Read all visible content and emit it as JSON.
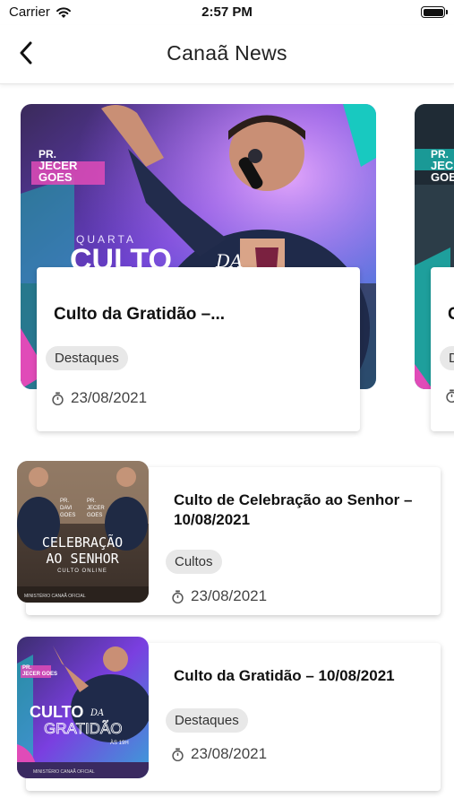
{
  "status": {
    "carrier": "Carrier",
    "time": "2:57 PM"
  },
  "header": {
    "title": "Canaã News"
  },
  "featured": [
    {
      "title": "Culto da Gratidão –...",
      "category": "Destaques",
      "date": "23/08/2021",
      "image_text": {
        "pastor": "PR. JECER GOES",
        "day": "QUARTA",
        "headline": "CULTO DA"
      }
    },
    {
      "title": "C",
      "category": "D",
      "date": "",
      "image_text": {
        "pastor": "PR. JECER GOES"
      }
    }
  ],
  "list": [
    {
      "title": "Culto de Celebração ao Senhor – 10/08/2021",
      "category": "Cultos",
      "date": "23/08/2021",
      "image_text": {
        "pastors": [
          "PR. DAVI GOES",
          "PR. JECER GOES"
        ],
        "headline": "CELEBRAÇÃO AO SENHOR",
        "sub": "CULTO ONLINE",
        "footer": "MINISTÉRIO CANAÃ OFICIAL"
      }
    },
    {
      "title": "Culto da Gratidão – 10/08/2021",
      "category": "Destaques",
      "date": "23/08/2021",
      "image_text": {
        "pastor": "PR. JECER GOES",
        "headline": "CULTO DA GRATIDÃO",
        "time": "ÀS 19H",
        "footer": "MINISTÉRIO CANAÃ OFICIAL"
      }
    }
  ],
  "colors": {
    "accent_purple": "#8a3cf0",
    "accent_teal": "#18c9c0",
    "accent_pink": "#e04bb8",
    "chip_bg": "#e8e8e8"
  },
  "icons": {
    "back": "chevron-left-icon",
    "timer": "stopwatch-icon",
    "wifi": "wifi-icon",
    "battery": "battery-icon"
  }
}
